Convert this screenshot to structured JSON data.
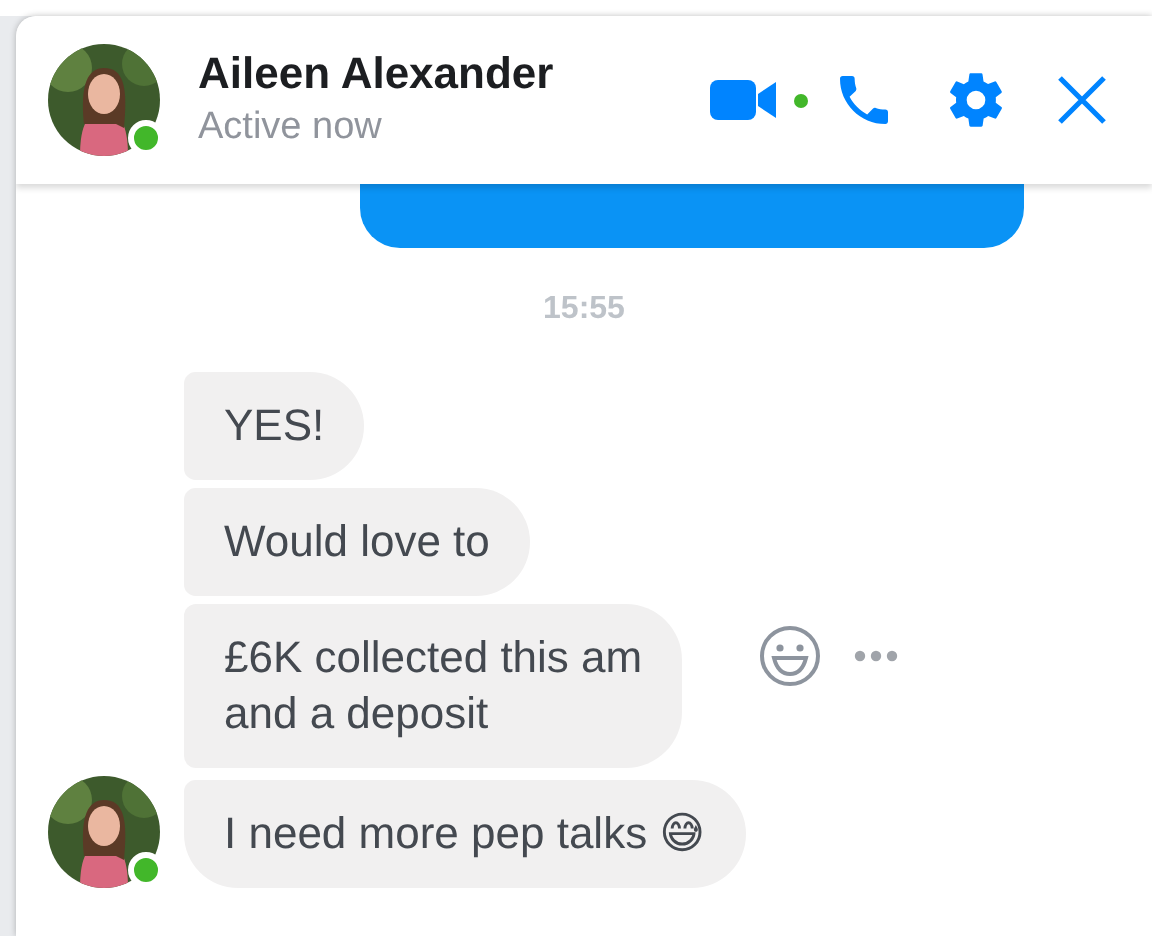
{
  "header": {
    "contact": "Aileen Alexander",
    "status": "Active now",
    "online": true,
    "call_available": true,
    "actions": [
      {
        "kind": "video"
      },
      {
        "kind": "call"
      },
      {
        "kind": "settings"
      },
      {
        "kind": "close"
      }
    ]
  },
  "messages": [
    {
      "kind": "outgoing"
    },
    {
      "kind": "timestamp",
      "text": "15:55"
    },
    {
      "kind": "incoming",
      "text": "YES!"
    },
    {
      "kind": "incoming",
      "text": "Would love to"
    },
    {
      "kind": "incoming",
      "text": "£6K collected this am\nand a deposit",
      "hovered": true
    },
    {
      "kind": "incoming",
      "text": "I need more pep talks 😅",
      "avatar": true,
      "online": true
    }
  ]
}
